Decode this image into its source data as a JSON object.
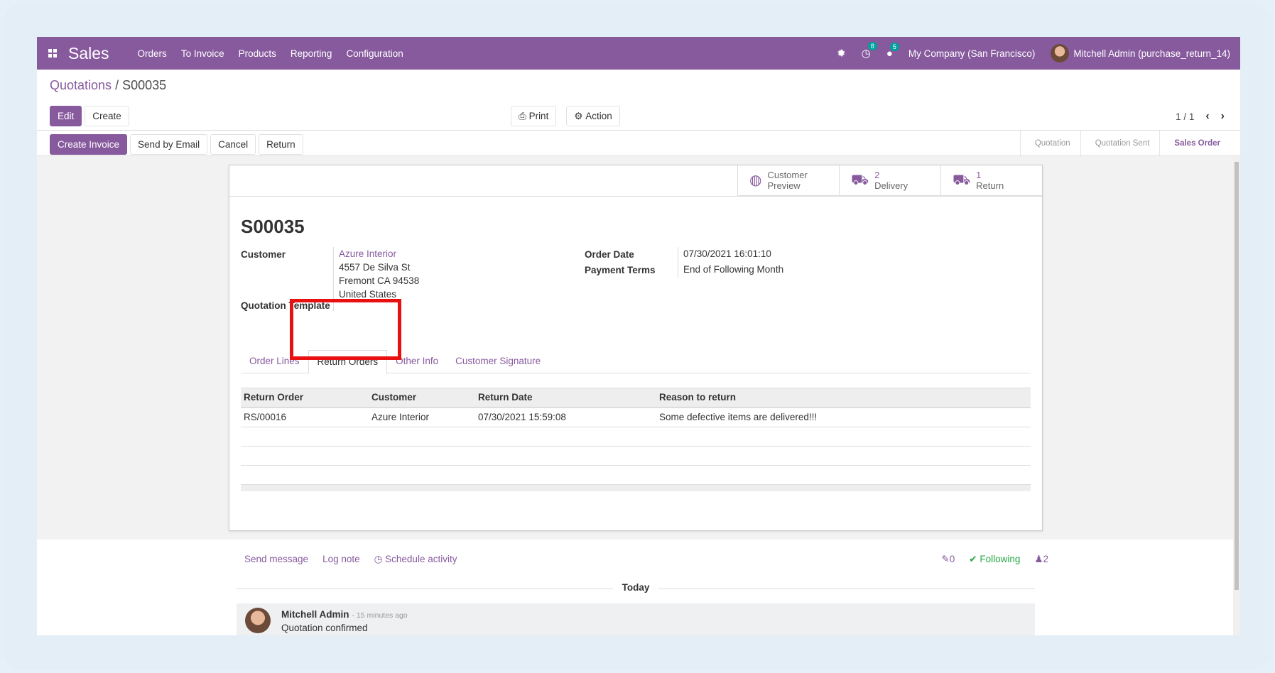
{
  "navbar": {
    "app_name": "Sales",
    "menu": [
      "Orders",
      "To Invoice",
      "Products",
      "Reporting",
      "Configuration"
    ],
    "bug_icon": "bug-icon",
    "activity_count": "8",
    "messages_count": "5",
    "company": "My Company (San Francisco)",
    "user": "Mitchell Admin (purchase_return_14)"
  },
  "breadcrumb": {
    "parent": "Quotations",
    "separator": "/",
    "current": "S00035"
  },
  "toolbar": {
    "edit": "Edit",
    "create": "Create",
    "print": "Print",
    "action": "Action",
    "pager": "1 / 1"
  },
  "status_buttons": {
    "create_invoice": "Create Invoice",
    "send_email": "Send by Email",
    "cancel": "Cancel",
    "return": "Return"
  },
  "stages": [
    "Quotation",
    "Quotation Sent",
    "Sales Order"
  ],
  "smart_buttons": {
    "preview": {
      "line1": "Customer",
      "line2": "Preview"
    },
    "delivery": {
      "count": "2",
      "label": "Delivery"
    },
    "return": {
      "count": "1",
      "label": "Return"
    }
  },
  "order": {
    "name": "S00035",
    "customer_label": "Customer",
    "customer_name": "Azure Interior",
    "address1": "4557 De Silva St",
    "address2": "Fremont CA 94538",
    "address3": "United States",
    "template_label": "Quotation Template",
    "order_date_label": "Order Date",
    "order_date": "07/30/2021 16:01:10",
    "payment_terms_label": "Payment Terms",
    "payment_terms": "End of Following Month"
  },
  "tabs": [
    "Order Lines",
    "Return Orders",
    "Other Info",
    "Customer Signature"
  ],
  "returns_table": {
    "headers": [
      "Return Order",
      "Customer",
      "Return Date",
      "Reason to return"
    ],
    "rows": [
      [
        "RS/00016",
        "Azure Interior",
        "07/30/2021 15:59:08",
        "Some defective items are delivered!!!"
      ]
    ]
  },
  "chatter": {
    "send_message": "Send message",
    "log_note": "Log note",
    "schedule": "Schedule activity",
    "attachments": "0",
    "following": "Following",
    "followers": "2",
    "today": "Today",
    "author": "Mitchell Admin",
    "time": "- 15 minutes ago",
    "body": "Quotation confirmed"
  },
  "colors": {
    "brand": "#875a9e",
    "highlight": "#e81010",
    "following": "#28a745"
  }
}
